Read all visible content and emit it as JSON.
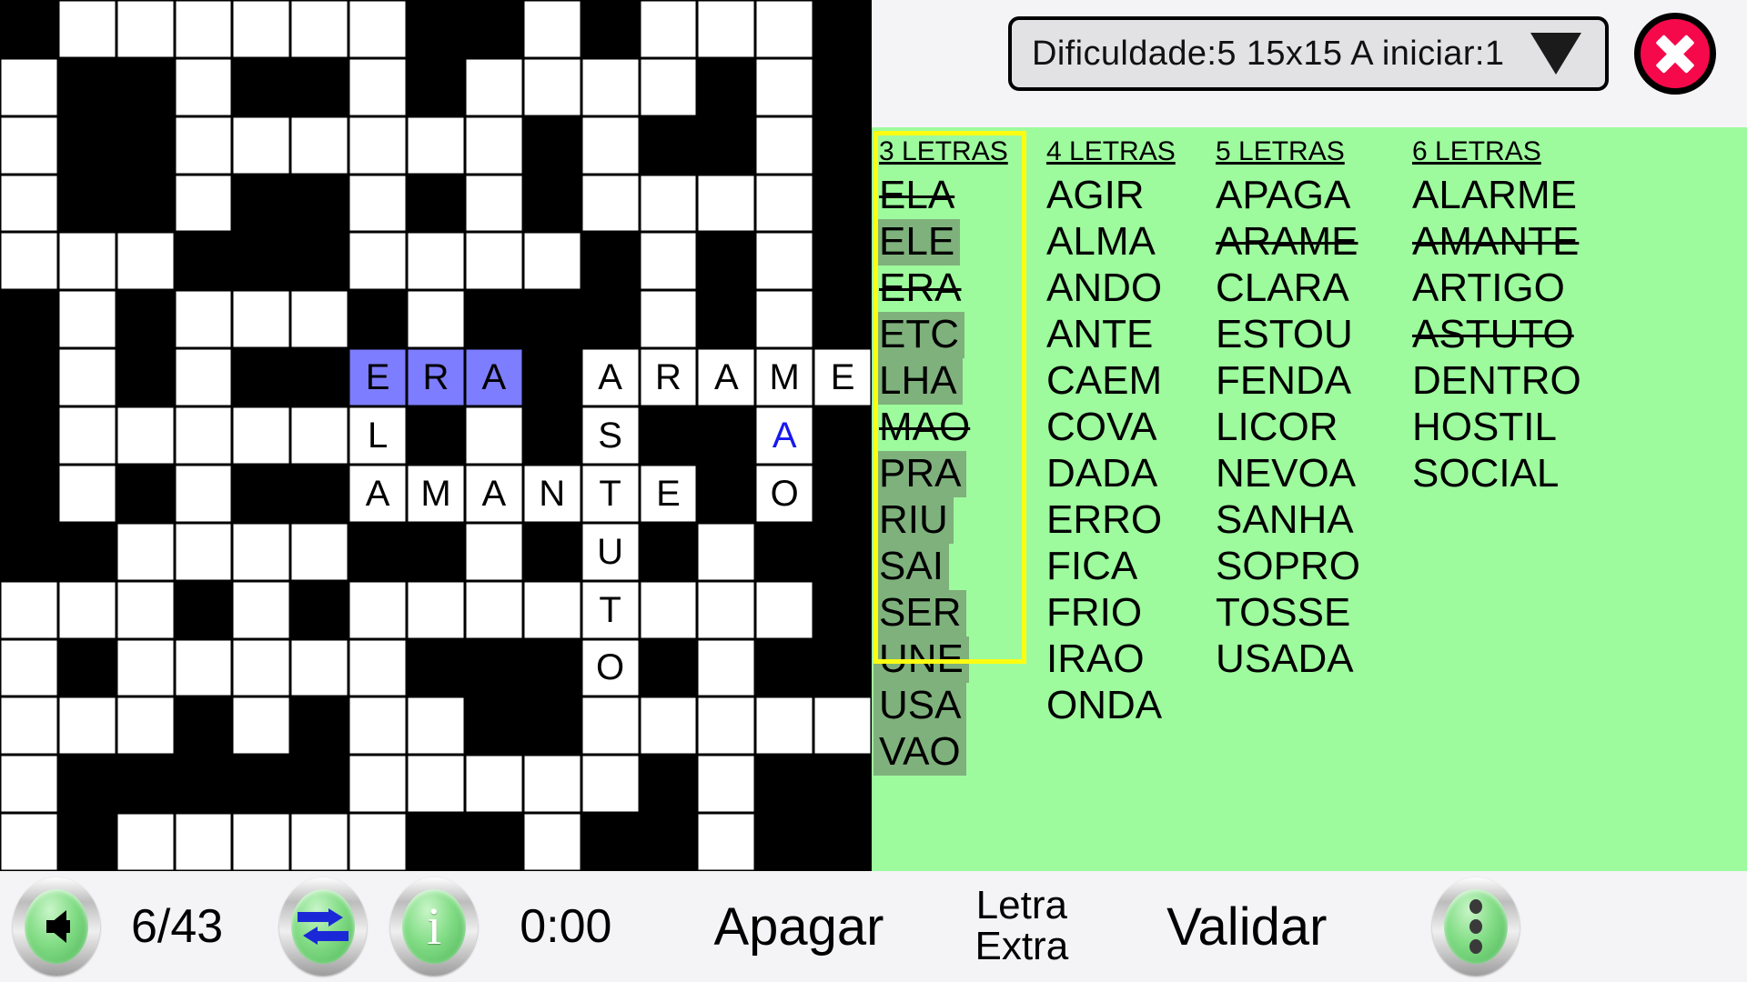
{
  "header": {
    "status_text": "Dificuldade:5  15x15  A iniciar:1",
    "caret_icon": "triangle-down-icon",
    "close_icon": "close-x-icon"
  },
  "grid": {
    "rows": 15,
    "cols": 15,
    "colors": {
      "open": "#ffffff",
      "block": "#000000",
      "selected": "#7d7dff",
      "extra_letter": "#1818f0"
    },
    "cells": [
      [
        {
          "t": "b"
        },
        {
          "t": "o"
        },
        {
          "t": "o"
        },
        {
          "t": "o"
        },
        {
          "t": "o"
        },
        {
          "t": "o"
        },
        {
          "t": "o"
        },
        {
          "t": "b"
        },
        {
          "t": "b"
        },
        {
          "t": "o"
        },
        {
          "t": "b"
        },
        {
          "t": "o"
        },
        {
          "t": "o"
        },
        {
          "t": "o"
        },
        {
          "t": "b"
        }
      ],
      [
        {
          "t": "o"
        },
        {
          "t": "b"
        },
        {
          "t": "b"
        },
        {
          "t": "o"
        },
        {
          "t": "b"
        },
        {
          "t": "b"
        },
        {
          "t": "o"
        },
        {
          "t": "b"
        },
        {
          "t": "o"
        },
        {
          "t": "o"
        },
        {
          "t": "o"
        },
        {
          "t": "o"
        },
        {
          "t": "b"
        },
        {
          "t": "o"
        },
        {
          "t": "b"
        }
      ],
      [
        {
          "t": "o"
        },
        {
          "t": "b"
        },
        {
          "t": "b"
        },
        {
          "t": "o"
        },
        {
          "t": "o"
        },
        {
          "t": "o"
        },
        {
          "t": "o"
        },
        {
          "t": "o"
        },
        {
          "t": "o"
        },
        {
          "t": "b"
        },
        {
          "t": "o"
        },
        {
          "t": "b"
        },
        {
          "t": "b"
        },
        {
          "t": "o"
        },
        {
          "t": "b"
        }
      ],
      [
        {
          "t": "o"
        },
        {
          "t": "b"
        },
        {
          "t": "b"
        },
        {
          "t": "o"
        },
        {
          "t": "b"
        },
        {
          "t": "b"
        },
        {
          "t": "o"
        },
        {
          "t": "b"
        },
        {
          "t": "o"
        },
        {
          "t": "b"
        },
        {
          "t": "o"
        },
        {
          "t": "o"
        },
        {
          "t": "o"
        },
        {
          "t": "o"
        },
        {
          "t": "b"
        }
      ],
      [
        {
          "t": "o"
        },
        {
          "t": "o"
        },
        {
          "t": "o"
        },
        {
          "t": "b"
        },
        {
          "t": "b"
        },
        {
          "t": "b"
        },
        {
          "t": "o"
        },
        {
          "t": "o"
        },
        {
          "t": "o"
        },
        {
          "t": "o"
        },
        {
          "t": "b"
        },
        {
          "t": "o"
        },
        {
          "t": "b"
        },
        {
          "t": "o"
        },
        {
          "t": "b"
        }
      ],
      [
        {
          "t": "b"
        },
        {
          "t": "o"
        },
        {
          "t": "b"
        },
        {
          "t": "o"
        },
        {
          "t": "o"
        },
        {
          "t": "o"
        },
        {
          "t": "b"
        },
        {
          "t": "o"
        },
        {
          "t": "b"
        },
        {
          "t": "b"
        },
        {
          "t": "b"
        },
        {
          "t": "o"
        },
        {
          "t": "b"
        },
        {
          "t": "o"
        },
        {
          "t": "b"
        }
      ],
      [
        {
          "t": "b"
        },
        {
          "t": "o"
        },
        {
          "t": "b"
        },
        {
          "t": "o"
        },
        {
          "t": "b"
        },
        {
          "t": "b"
        },
        {
          "t": "o",
          "c": "E",
          "s": true
        },
        {
          "t": "o",
          "c": "R",
          "s": true
        },
        {
          "t": "o",
          "c": "A",
          "s": true
        },
        {
          "t": "b"
        },
        {
          "t": "o",
          "c": "A"
        },
        {
          "t": "o",
          "c": "R"
        },
        {
          "t": "o",
          "c": "A"
        },
        {
          "t": "o",
          "c": "M"
        },
        {
          "t": "o",
          "c": "E"
        }
      ],
      [
        {
          "t": "b"
        },
        {
          "t": "o"
        },
        {
          "t": "o"
        },
        {
          "t": "o"
        },
        {
          "t": "o"
        },
        {
          "t": "o"
        },
        {
          "t": "o",
          "c": "L"
        },
        {
          "t": "b"
        },
        {
          "t": "o"
        },
        {
          "t": "b"
        },
        {
          "t": "o",
          "c": "S"
        },
        {
          "t": "b"
        },
        {
          "t": "b"
        },
        {
          "t": "o",
          "c": "A",
          "x": true
        },
        {
          "t": "b"
        }
      ],
      [
        {
          "t": "b"
        },
        {
          "t": "o"
        },
        {
          "t": "b"
        },
        {
          "t": "o"
        },
        {
          "t": "b"
        },
        {
          "t": "b"
        },
        {
          "t": "o",
          "c": "A"
        },
        {
          "t": "o",
          "c": "M"
        },
        {
          "t": "o",
          "c": "A"
        },
        {
          "t": "o",
          "c": "N"
        },
        {
          "t": "o",
          "c": "T"
        },
        {
          "t": "o",
          "c": "E"
        },
        {
          "t": "b"
        },
        {
          "t": "o",
          "c": "O"
        },
        {
          "t": "b"
        }
      ],
      [
        {
          "t": "b"
        },
        {
          "t": "b"
        },
        {
          "t": "o"
        },
        {
          "t": "o"
        },
        {
          "t": "o"
        },
        {
          "t": "o"
        },
        {
          "t": "b"
        },
        {
          "t": "b"
        },
        {
          "t": "o"
        },
        {
          "t": "b"
        },
        {
          "t": "o",
          "c": "U"
        },
        {
          "t": "b"
        },
        {
          "t": "o"
        },
        {
          "t": "b"
        },
        {
          "t": "b"
        }
      ],
      [
        {
          "t": "o"
        },
        {
          "t": "o"
        },
        {
          "t": "o"
        },
        {
          "t": "b"
        },
        {
          "t": "o"
        },
        {
          "t": "b"
        },
        {
          "t": "o"
        },
        {
          "t": "o"
        },
        {
          "t": "o"
        },
        {
          "t": "o"
        },
        {
          "t": "o",
          "c": "T"
        },
        {
          "t": "o"
        },
        {
          "t": "o"
        },
        {
          "t": "o"
        },
        {
          "t": "b"
        }
      ],
      [
        {
          "t": "o"
        },
        {
          "t": "b"
        },
        {
          "t": "o"
        },
        {
          "t": "o"
        },
        {
          "t": "o"
        },
        {
          "t": "o"
        },
        {
          "t": "o"
        },
        {
          "t": "b"
        },
        {
          "t": "b"
        },
        {
          "t": "b"
        },
        {
          "t": "o",
          "c": "O"
        },
        {
          "t": "b"
        },
        {
          "t": "o"
        },
        {
          "t": "b"
        },
        {
          "t": "b"
        }
      ],
      [
        {
          "t": "o"
        },
        {
          "t": "o"
        },
        {
          "t": "o"
        },
        {
          "t": "b"
        },
        {
          "t": "o"
        },
        {
          "t": "b"
        },
        {
          "t": "o"
        },
        {
          "t": "o"
        },
        {
          "t": "b"
        },
        {
          "t": "b"
        },
        {
          "t": "o"
        },
        {
          "t": "o"
        },
        {
          "t": "o"
        },
        {
          "t": "o"
        },
        {
          "t": "o"
        }
      ],
      [
        {
          "t": "o"
        },
        {
          "t": "b"
        },
        {
          "t": "b"
        },
        {
          "t": "b"
        },
        {
          "t": "b"
        },
        {
          "t": "b"
        },
        {
          "t": "o"
        },
        {
          "t": "o"
        },
        {
          "t": "o"
        },
        {
          "t": "o"
        },
        {
          "t": "o"
        },
        {
          "t": "b"
        },
        {
          "t": "o"
        },
        {
          "t": "b"
        },
        {
          "t": "b"
        }
      ],
      [
        {
          "t": "o"
        },
        {
          "t": "b"
        },
        {
          "t": "o"
        },
        {
          "t": "o"
        },
        {
          "t": "o"
        },
        {
          "t": "o"
        },
        {
          "t": "o"
        },
        {
          "t": "b"
        },
        {
          "t": "b"
        },
        {
          "t": "o"
        },
        {
          "t": "b"
        },
        {
          "t": "b"
        },
        {
          "t": "o"
        },
        {
          "t": "b"
        },
        {
          "t": "b"
        }
      ]
    ]
  },
  "word_panel": {
    "background": "#9dfb9d",
    "highlight": "#7fb17c",
    "frame_color": "#fdfd12",
    "columns": [
      {
        "header": "3 LETRAS",
        "active": true,
        "words": [
          {
            "w": "ELA",
            "used": true,
            "hl": false
          },
          {
            "w": "ELE",
            "used": false,
            "hl": true
          },
          {
            "w": "ERA",
            "used": true,
            "hl": false
          },
          {
            "w": "ETC",
            "used": false,
            "hl": true
          },
          {
            "w": "LHA",
            "used": false,
            "hl": true
          },
          {
            "w": "MAO",
            "used": true,
            "hl": false
          },
          {
            "w": "PRA",
            "used": false,
            "hl": true
          },
          {
            "w": "RIU",
            "used": false,
            "hl": true
          },
          {
            "w": "SAI",
            "used": false,
            "hl": true
          },
          {
            "w": "SER",
            "used": false,
            "hl": true
          },
          {
            "w": "UNE",
            "used": false,
            "hl": true
          },
          {
            "w": "USA",
            "used": false,
            "hl": true
          },
          {
            "w": "VAO",
            "used": false,
            "hl": true
          }
        ]
      },
      {
        "header": "4 LETRAS",
        "active": false,
        "words": [
          {
            "w": "AGIR",
            "used": false,
            "hl": false
          },
          {
            "w": "ALMA",
            "used": false,
            "hl": false
          },
          {
            "w": "ANDO",
            "used": false,
            "hl": false
          },
          {
            "w": "ANTE",
            "used": false,
            "hl": false
          },
          {
            "w": "CAEM",
            "used": false,
            "hl": false
          },
          {
            "w": "COVA",
            "used": false,
            "hl": false
          },
          {
            "w": "DADA",
            "used": false,
            "hl": false
          },
          {
            "w": "ERRO",
            "used": false,
            "hl": false
          },
          {
            "w": "FICA",
            "used": false,
            "hl": false
          },
          {
            "w": "FRIO",
            "used": false,
            "hl": false
          },
          {
            "w": "IRAO",
            "used": false,
            "hl": false
          },
          {
            "w": "ONDA",
            "used": false,
            "hl": false
          }
        ]
      },
      {
        "header": "5 LETRAS",
        "active": false,
        "words": [
          {
            "w": "APAGA",
            "used": false,
            "hl": false
          },
          {
            "w": "ARAME",
            "used": true,
            "hl": false
          },
          {
            "w": "CLARA",
            "used": false,
            "hl": false
          },
          {
            "w": "ESTOU",
            "used": false,
            "hl": false
          },
          {
            "w": "FENDA",
            "used": false,
            "hl": false
          },
          {
            "w": "LICOR",
            "used": false,
            "hl": false
          },
          {
            "w": "NEVOA",
            "used": false,
            "hl": false
          },
          {
            "w": "SANHA",
            "used": false,
            "hl": false
          },
          {
            "w": "SOPRO",
            "used": false,
            "hl": false
          },
          {
            "w": "TOSSE",
            "used": false,
            "hl": false
          },
          {
            "w": "USADA",
            "used": false,
            "hl": false
          }
        ]
      },
      {
        "header": "6 LETRAS",
        "active": false,
        "words": [
          {
            "w": "ALARME",
            "used": false,
            "hl": false
          },
          {
            "w": "AMANTE",
            "used": true,
            "hl": false
          },
          {
            "w": "ARTIGO",
            "used": false,
            "hl": false
          },
          {
            "w": "ASTUTO",
            "used": true,
            "hl": false
          },
          {
            "w": "DENTRO",
            "used": false,
            "hl": false
          },
          {
            "w": "HOSTIL",
            "used": false,
            "hl": false
          },
          {
            "w": "SOCIAL",
            "used": false,
            "hl": false
          }
        ]
      }
    ]
  },
  "toolbar": {
    "back_icon": "arrow-left-icon",
    "progress": "6/43",
    "swap_icon": "swap-arrows-icon",
    "info_icon": "info-icon",
    "timer": "0:00",
    "erase_label": "Apagar",
    "extra_letter_line1": "Letra",
    "extra_letter_line2": "Extra",
    "validate_label": "Validar",
    "menu_icon": "more-vertical-icon"
  }
}
